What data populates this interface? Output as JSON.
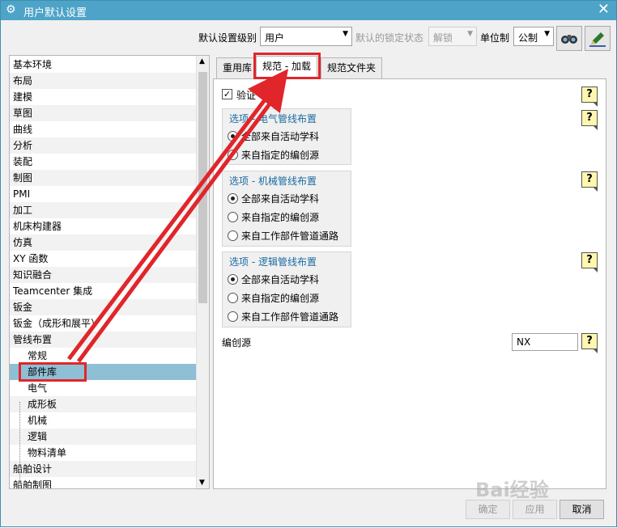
{
  "window": {
    "title": "用户默认设置",
    "icon": "gear-icon",
    "close_label": "✕"
  },
  "toolbar": {
    "level_label": "默认设置级别",
    "level_value": "用户",
    "lock_label": "默认的锁定状态",
    "lock_value": "解锁",
    "unit_label": "单位制",
    "unit_value": "公制",
    "tool_icons": [
      "binoculars-icon",
      "edit-pen-icon"
    ]
  },
  "tree": {
    "items": [
      "基本环境",
      "布局",
      "建模",
      "草图",
      "曲线",
      "分析",
      "装配",
      "制图",
      "PMI",
      "加工",
      "机床构建器",
      "仿真",
      "XY 函数",
      "知识融合",
      "Teamcenter 集成",
      "钣金",
      "钣金（成形和展平）",
      "管线布置"
    ],
    "children": [
      "常规",
      "部件库",
      "电气",
      "成形板",
      "机械",
      "逻辑",
      "物料清单"
    ],
    "after": [
      "船舶设计",
      "船舶制图"
    ]
  },
  "tabs": [
    "重用库",
    "规范 - 加载",
    "规范文件夹"
  ],
  "panel": {
    "verify_label": "验证",
    "help_mark": "?",
    "groups": [
      {
        "title": "选项 - 电气管线布置",
        "options": [
          "全部来自活动学科",
          "来自指定的编创源"
        ],
        "selected": 0
      },
      {
        "title": "选项 - 机械管线布置",
        "options": [
          "全部来自活动学科",
          "来自指定的编创源",
          "来自工作部件管道通路"
        ],
        "selected": 0
      },
      {
        "title": "选项 - 逻辑管线布置",
        "options": [
          "全部来自活动学科",
          "来自指定的编创源",
          "来自工作部件管道通路"
        ],
        "selected": 0
      }
    ],
    "source_label": "编创源",
    "source_value": "NX"
  },
  "buttons": {
    "ok": "确定",
    "apply": "应用",
    "cancel": "取消"
  },
  "watermark": "Bai经验",
  "colors": {
    "titlebar": "#4ea3c8",
    "selection": "#8fbfd4",
    "annotation": "#e0262b"
  }
}
